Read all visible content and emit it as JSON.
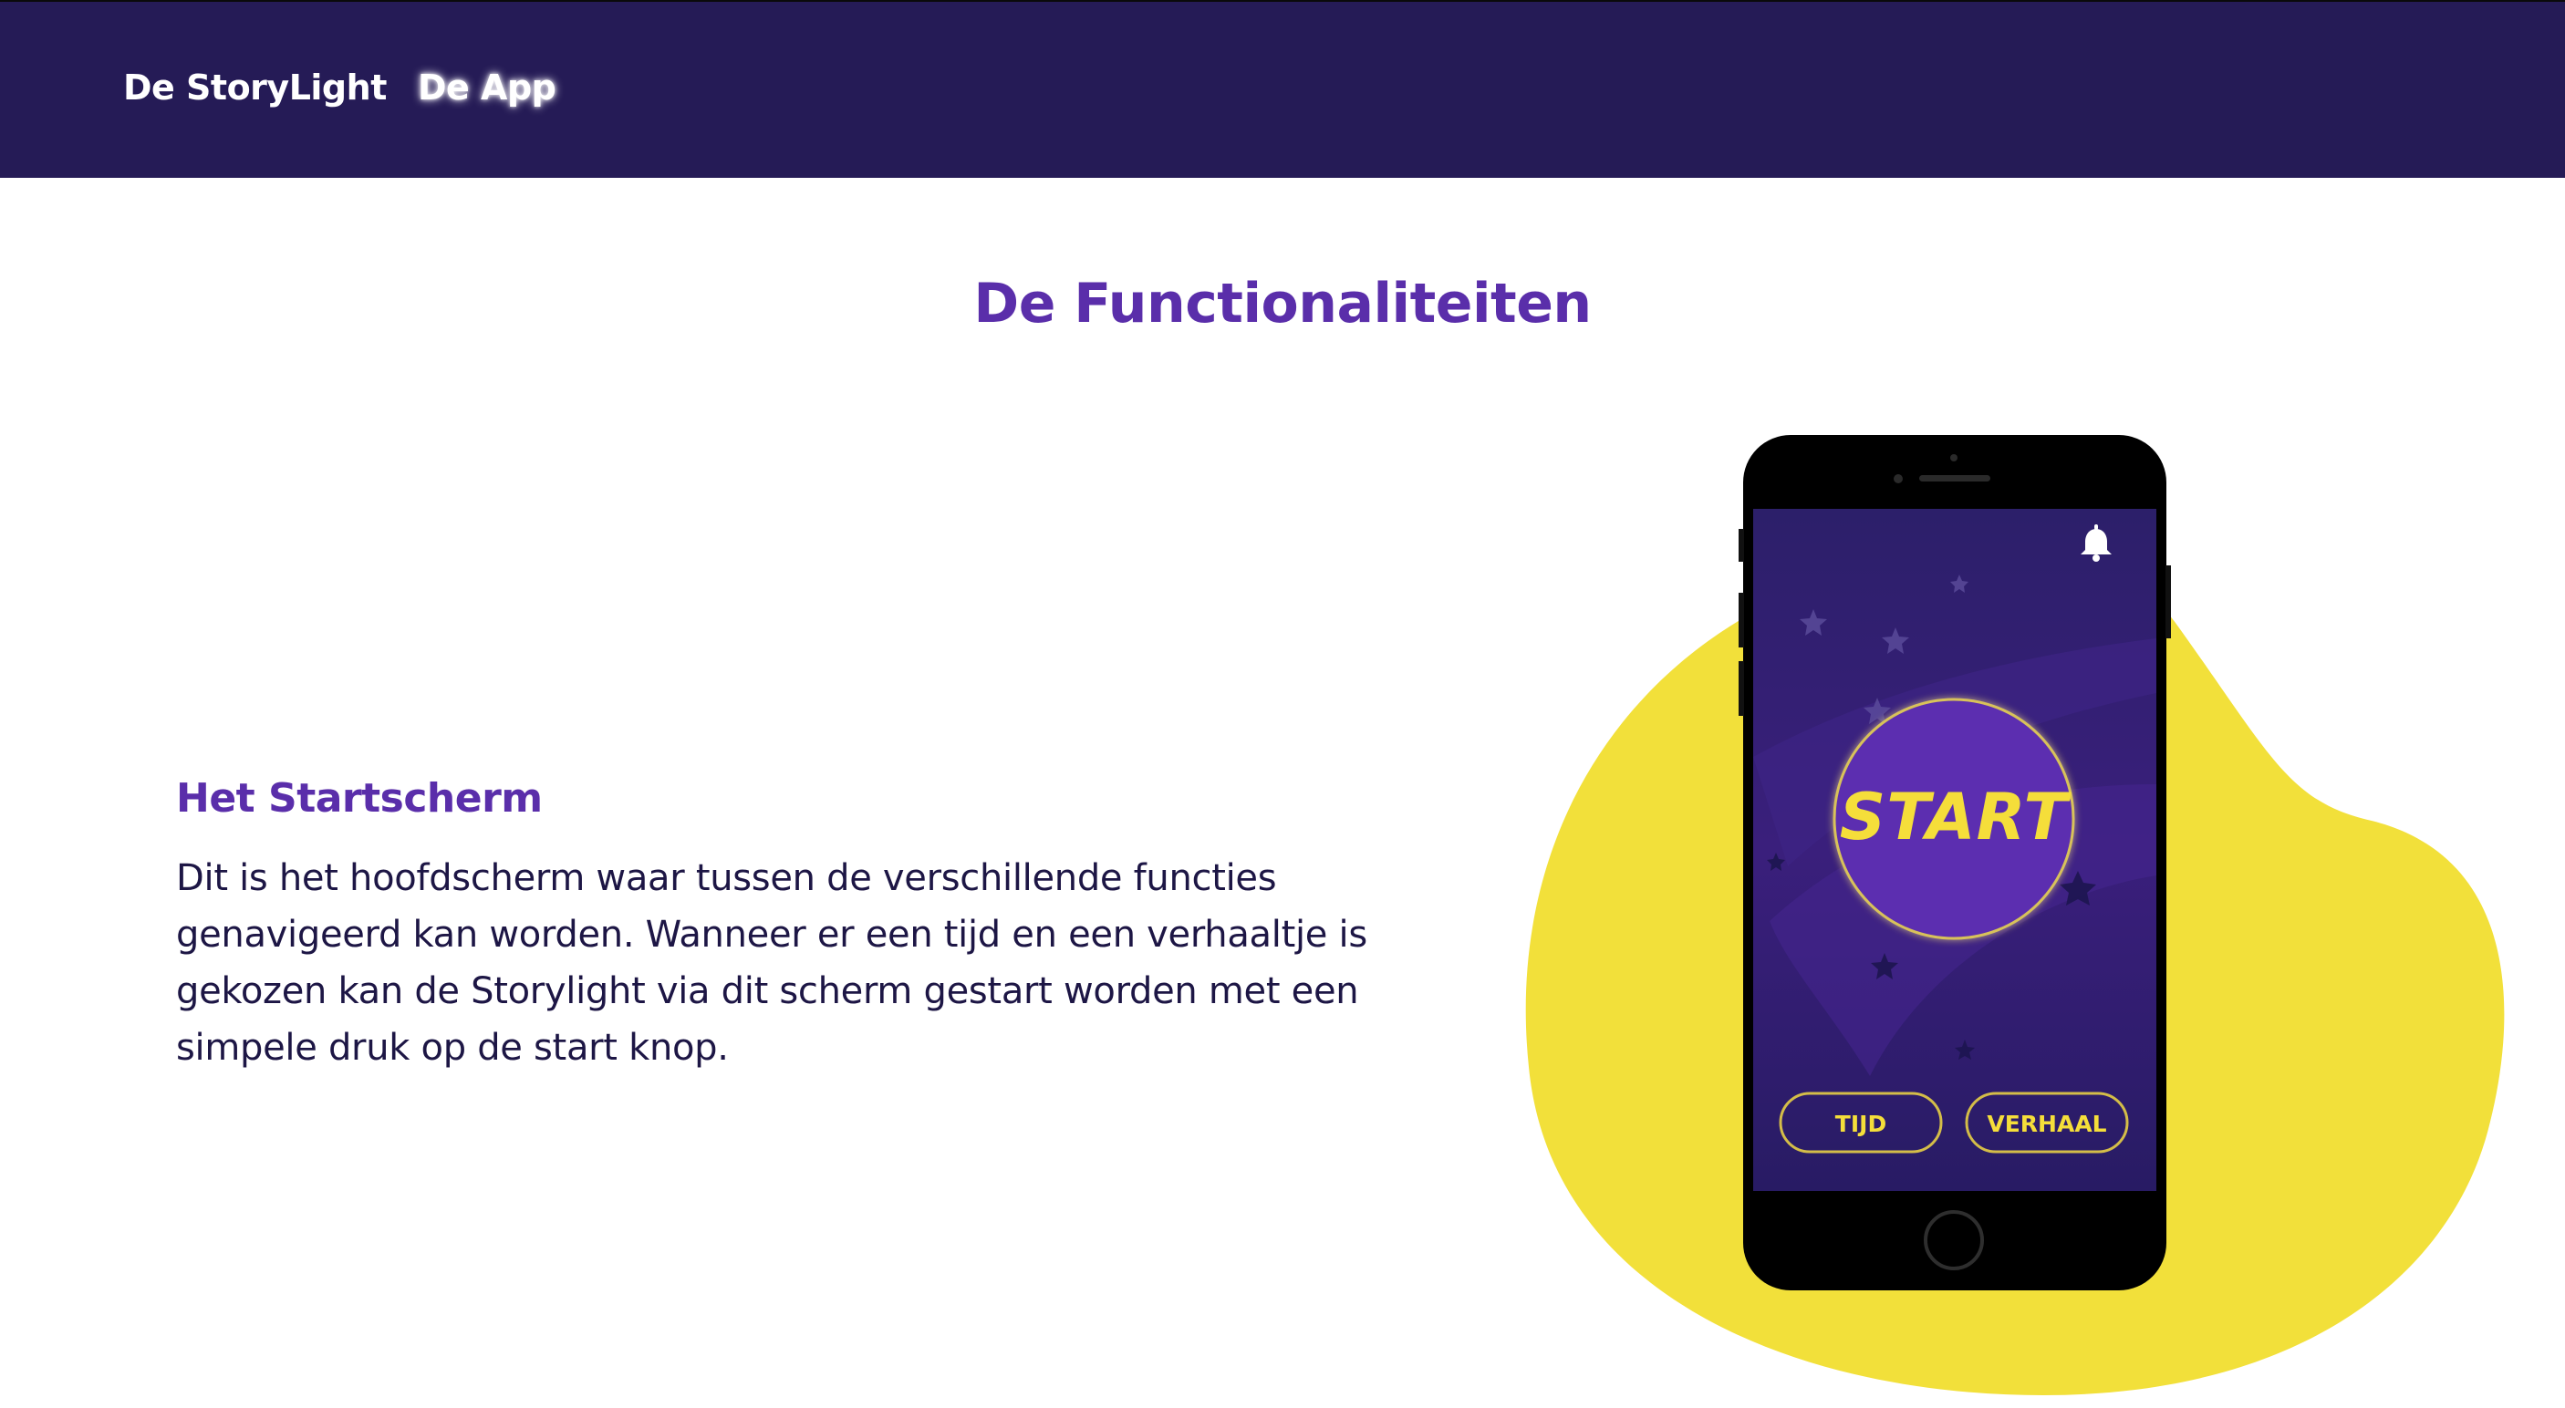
{
  "nav": {
    "items": [
      {
        "label": "De StoryLight"
      },
      {
        "label": "De App"
      }
    ],
    "background": "#251b56",
    "active_item": "De App"
  },
  "main": {
    "title": "De Functionaliteiten",
    "section": {
      "heading": "Het Startscherm",
      "body": "Dit is het hoofdscherm waar tussen de verschillende functies genavigeerd kan worden. Wanneer er een tijd en een verhaaltje is gekozen kan de Storylight via dit scherm gestart worden met een simpele druk op de start knop."
    }
  },
  "phone": {
    "start_label": "START",
    "time_label": "TIJD",
    "story_label": "VERHAAL",
    "notification_icon": "bell-icon"
  },
  "colors": {
    "accent_purple": "#5a2eaa",
    "text_dark": "#1d1645",
    "blob_yellow": "#f2e03a",
    "phone_screen": "#2e1d6e",
    "button_yellow": "#f5de3a"
  }
}
